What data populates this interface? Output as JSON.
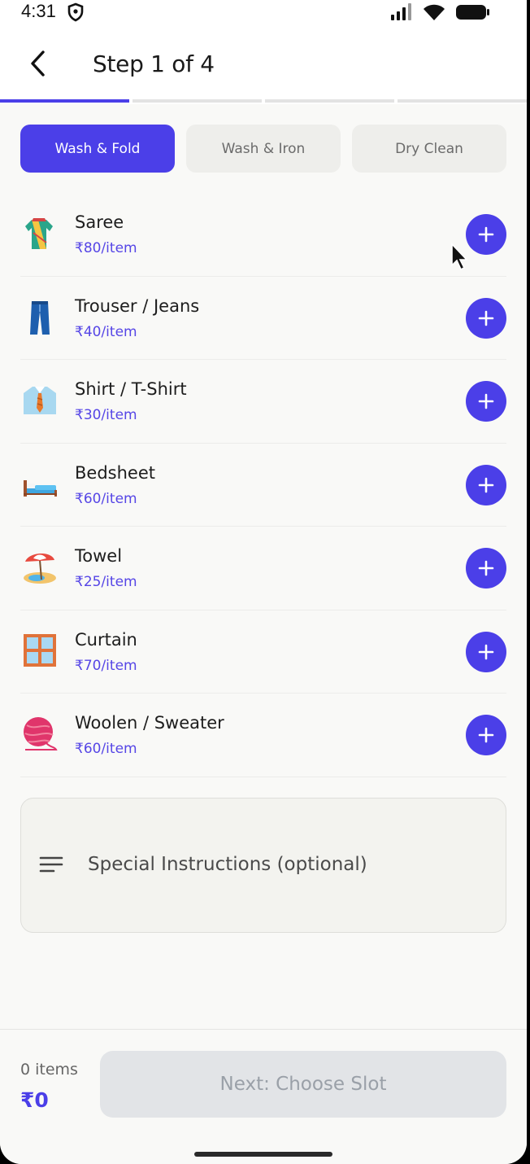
{
  "status": {
    "time": "4:31"
  },
  "header": {
    "title": "Step 1 of 4",
    "progress_steps": 4,
    "progress_current": 1
  },
  "tabs": [
    {
      "label": "Wash & Fold",
      "active": true
    },
    {
      "label": "Wash & Iron",
      "active": false
    },
    {
      "label": "Dry Clean",
      "active": false
    }
  ],
  "items": [
    {
      "name": "Saree",
      "price": "₹80/item",
      "icon": "saree-icon"
    },
    {
      "name": "Trouser / Jeans",
      "price": "₹40/item",
      "icon": "jeans-icon"
    },
    {
      "name": "Shirt / T-Shirt",
      "price": "₹30/item",
      "icon": "shirt-icon"
    },
    {
      "name": "Bedsheet",
      "price": "₹60/item",
      "icon": "bed-icon"
    },
    {
      "name": "Towel",
      "price": "₹25/item",
      "icon": "beach-umbrella-icon"
    },
    {
      "name": "Curtain",
      "price": "₹70/item",
      "icon": "window-icon"
    },
    {
      "name": "Woolen / Sweater",
      "price": "₹60/item",
      "icon": "yarn-icon"
    }
  ],
  "instructions": {
    "placeholder": "Special Instructions (optional)"
  },
  "footer": {
    "count": "0 items",
    "total": "₹0",
    "next_label": "Next: Choose Slot"
  },
  "colors": {
    "accent": "#4b3fe8",
    "price": "#5646e6",
    "disabled_bg": "#e2e4e7",
    "disabled_text": "#9aa0a8"
  }
}
